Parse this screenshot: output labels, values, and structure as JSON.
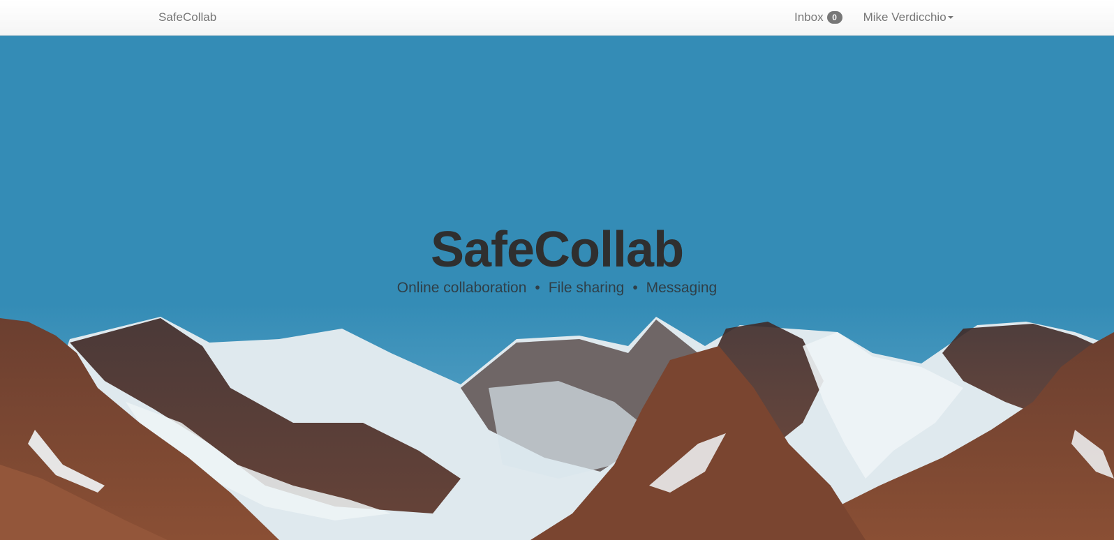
{
  "navbar": {
    "brand": "SafeCollab",
    "inbox_label": "Inbox",
    "inbox_count": "0",
    "user_name": "Mike Verdicchio"
  },
  "hero": {
    "title": "SafeCollab",
    "features": [
      "Online collaboration",
      "File sharing",
      "Messaging"
    ],
    "separator": "•",
    "background_color": "#348cb6"
  }
}
